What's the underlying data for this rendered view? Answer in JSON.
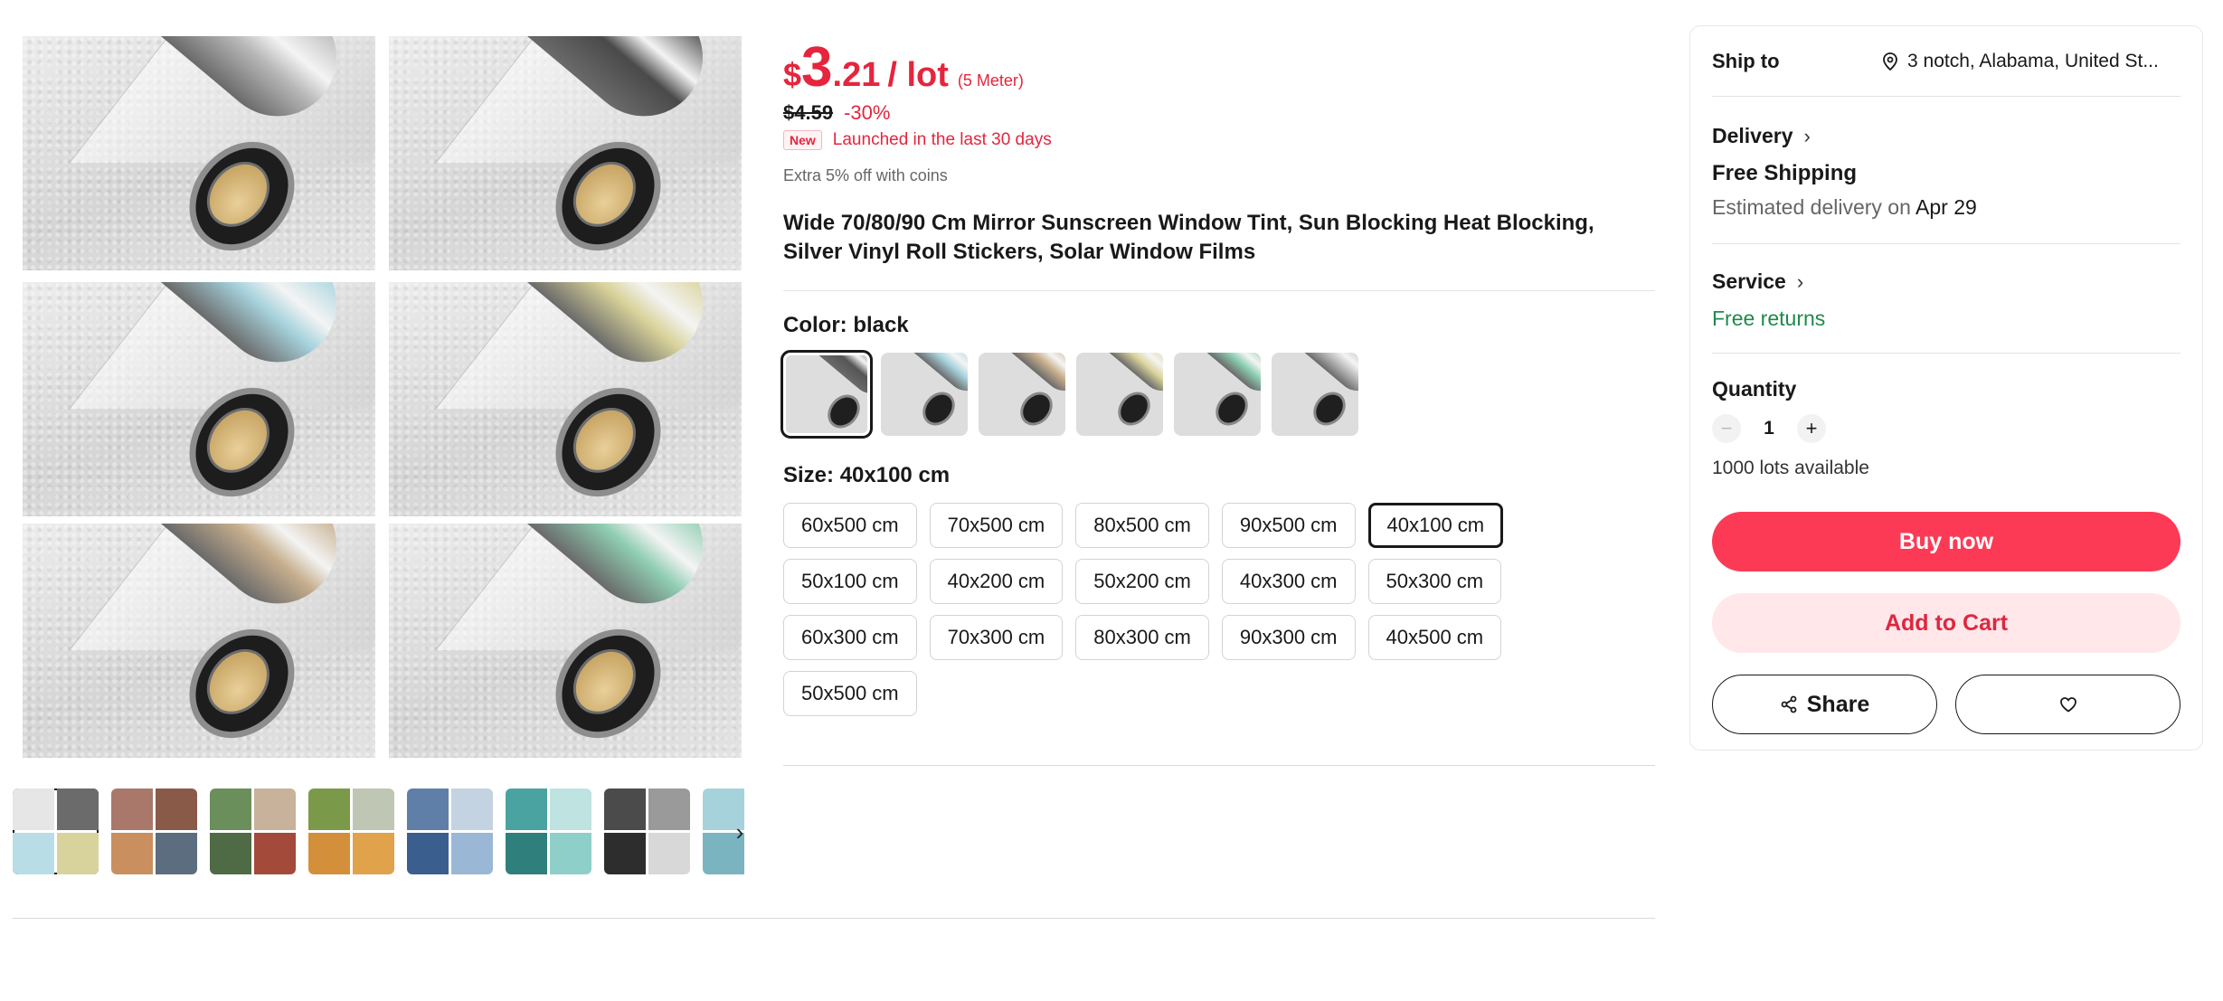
{
  "gallery": {
    "images": [
      {
        "name": "silver",
        "color": "#b8b8b8"
      },
      {
        "name": "black",
        "color": "#4a4a4a"
      },
      {
        "name": "blue",
        "color": "#a7d3dd"
      },
      {
        "name": "gold",
        "color": "#d9d39a"
      },
      {
        "name": "bronze",
        "color": "#c6ae8d"
      },
      {
        "name": "green",
        "color": "#8fcdb2"
      }
    ],
    "thumbs_next_icon": "›"
  },
  "product": {
    "price": {
      "symbol": "$",
      "integer": "3",
      "decimal": ".21",
      "unit": "/ lot",
      "note": "(5 Meter)"
    },
    "original_price": "$4.59",
    "discount": "-30%",
    "new_badge": "New",
    "new_text": "Launched in the last 30 days",
    "coins_text": "Extra 5% off with coins",
    "title": "Wide 70/80/90 Cm Mirror Sunscreen Window Tint, Sun Blocking Heat Blocking, Silver Vinyl Roll Stickers, Solar Window Films",
    "color_label": "Color: ",
    "color_value": "black",
    "swatches": [
      {
        "name": "black",
        "color": "#555555"
      },
      {
        "name": "blue",
        "color": "#a6d2dc"
      },
      {
        "name": "bronze",
        "color": "#c9b08e"
      },
      {
        "name": "gold",
        "color": "#dad39b"
      },
      {
        "name": "green",
        "color": "#8ccfb2"
      },
      {
        "name": "silver",
        "color": "#bdbdbd"
      }
    ],
    "selected_swatch": 0,
    "size_label": "Size: ",
    "size_value": "40x100 cm",
    "sizes": [
      "60x500 cm",
      "70x500 cm",
      "80x500 cm",
      "90x500 cm",
      "40x100 cm",
      "50x100 cm",
      "40x200 cm",
      "50x200 cm",
      "40x300 cm",
      "50x300 cm",
      "60x300 cm",
      "70x300 cm",
      "80x300 cm",
      "90x300 cm",
      "40x500 cm",
      "50x500 cm"
    ],
    "selected_size": 4
  },
  "panel": {
    "ship_to_label": "Ship to",
    "ship_to_value": "3 notch, Alabama, United St...",
    "delivery_label": "Delivery",
    "shipping": "Free Shipping",
    "eta_prefix": "Estimated delivery on ",
    "eta_date": "Apr 29",
    "service_label": "Service",
    "returns": "Free returns",
    "quantity_label": "Quantity",
    "quantity": "1",
    "minus": "−",
    "plus": "+",
    "available": "1000 lots available",
    "buy_now": "Buy now",
    "add_to_cart": "Add to Cart",
    "share": "Share"
  },
  "colors": {
    "accent": "#fd3a55",
    "price": "#e5253d",
    "green": "#1e8a4c"
  }
}
